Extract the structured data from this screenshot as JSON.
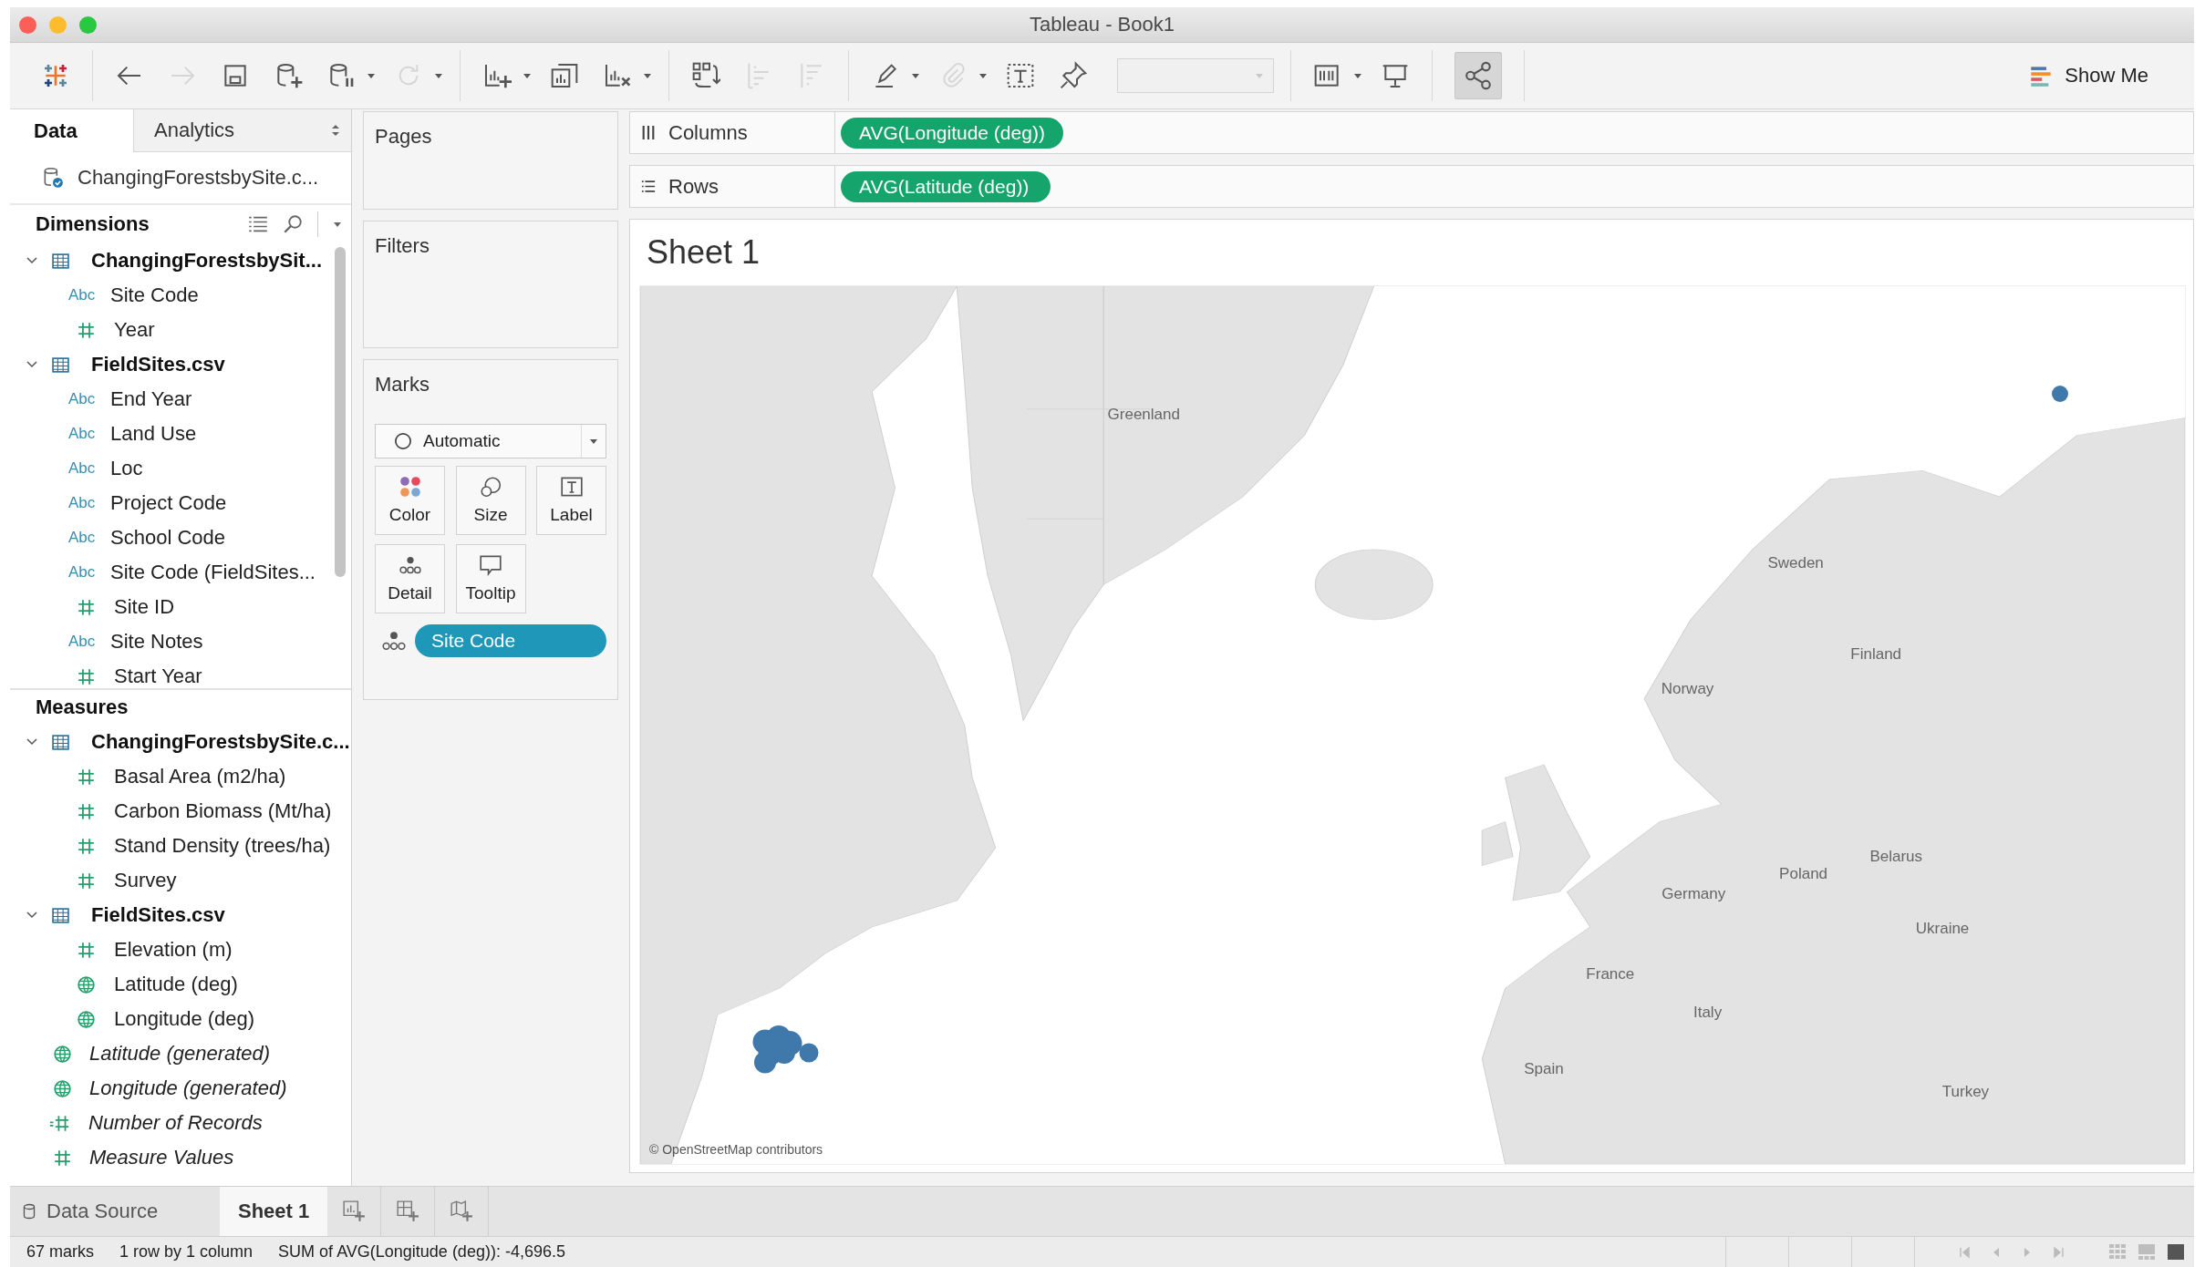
{
  "window": {
    "title": "Tableau - Book1"
  },
  "toolbar": {
    "groups": [
      [
        {
          "kind": "logo",
          "disabled": false,
          "menu": false,
          "on": false
        }
      ],
      [
        {
          "kind": "back",
          "disabled": false,
          "menu": false,
          "on": false
        },
        {
          "kind": "forward",
          "disabled": true,
          "menu": false,
          "on": false
        },
        {
          "kind": "save",
          "disabled": false,
          "menu": false,
          "on": false
        },
        {
          "kind": "new-data-source",
          "disabled": false,
          "menu": false,
          "on": false
        },
        {
          "kind": "pause",
          "disabled": false,
          "menu": true,
          "on": false
        },
        {
          "kind": "refresh",
          "disabled": true,
          "menu": true,
          "on": false
        }
      ],
      [
        {
          "kind": "new-worksheet",
          "disabled": false,
          "menu": true,
          "on": false
        },
        {
          "kind": "duplicate",
          "disabled": false,
          "menu": false,
          "on": false
        },
        {
          "kind": "clear",
          "disabled": false,
          "menu": true,
          "on": false
        }
      ],
      [
        {
          "kind": "swap",
          "disabled": false,
          "menu": false,
          "on": false
        },
        {
          "kind": "sort-ascending",
          "disabled": true,
          "menu": false,
          "on": false
        },
        {
          "kind": "sort-descending",
          "disabled": true,
          "menu": false,
          "on": false
        }
      ],
      [
        {
          "kind": "highlight",
          "disabled": false,
          "menu": true,
          "on": false
        },
        {
          "kind": "annotate",
          "disabled": true,
          "menu": true,
          "on": false
        },
        {
          "kind": "text",
          "disabled": false,
          "menu": false,
          "on": false
        },
        {
          "kind": "pin",
          "disabled": false,
          "menu": false,
          "on": false
        },
        {
          "kind": "combo",
          "disabled": true
        }
      ],
      [
        {
          "kind": "fit",
          "disabled": false,
          "menu": true,
          "on": false
        },
        {
          "kind": "presentation",
          "disabled": false,
          "menu": false,
          "on": false
        }
      ],
      [
        {
          "kind": "share",
          "disabled": false,
          "menu": false,
          "on": true
        }
      ]
    ],
    "show_me": {
      "label": "Show Me"
    }
  },
  "data_pane": {
    "tabs": [
      {
        "label": "Data",
        "selected": true
      },
      {
        "label": "Analytics",
        "selected": false
      }
    ],
    "data_source": "ChangingForestsbySite.c...",
    "dimensions": {
      "title": "Dimensions",
      "items": [
        {
          "kind": "table",
          "label": "ChangingForestsbySit...",
          "expanded": true,
          "children": [
            {
              "kind": "string",
              "badge": "Abc",
              "label": "Site Code",
              "generated": false
            },
            {
              "kind": "number",
              "label": "Year",
              "generated": false
            }
          ]
        },
        {
          "kind": "table",
          "label": "FieldSites.csv",
          "expanded": true,
          "children": [
            {
              "kind": "string",
              "badge": "Abc",
              "label": "End Year",
              "generated": false
            },
            {
              "kind": "string",
              "badge": "Abc",
              "label": "Land Use",
              "generated": false
            },
            {
              "kind": "string",
              "badge": "Abc",
              "label": "Loc",
              "generated": false
            },
            {
              "kind": "string",
              "badge": "Abc",
              "label": "Project Code",
              "generated": false
            },
            {
              "kind": "string",
              "badge": "Abc",
              "label": "School Code",
              "generated": false
            },
            {
              "kind": "string",
              "badge": "Abc",
              "label": "Site Code (FieldSites...",
              "generated": false
            },
            {
              "kind": "number",
              "label": "Site ID",
              "generated": false
            },
            {
              "kind": "string",
              "badge": "Abc",
              "label": "Site Notes",
              "generated": false
            },
            {
              "kind": "number",
              "label": "Start Year",
              "generated": false
            }
          ]
        }
      ]
    },
    "measures": {
      "title": "Measures",
      "items": [
        {
          "kind": "table",
          "label": "ChangingForestsbySite.c...",
          "expanded": true,
          "children": [
            {
              "kind": "number",
              "label": "Basal Area (m2/ha)",
              "generated": false
            },
            {
              "kind": "number",
              "label": "Carbon Biomass (Mt/ha)",
              "generated": false
            },
            {
              "kind": "number",
              "label": "Stand Density (trees/ha)",
              "generated": false
            },
            {
              "kind": "number",
              "label": "Survey",
              "generated": false
            }
          ]
        },
        {
          "kind": "table",
          "label": "FieldSites.csv",
          "expanded": true,
          "children": [
            {
              "kind": "number",
              "label": "Elevation (m)",
              "generated": false
            },
            {
              "kind": "geo",
              "label": "Latitude (deg)",
              "generated": false
            },
            {
              "kind": "geo",
              "label": "Longitude (deg)",
              "generated": false
            }
          ]
        },
        {
          "kind": "geo",
          "label": "Latitude (generated)",
          "generated": true
        },
        {
          "kind": "geo",
          "label": "Longitude (generated)",
          "generated": true
        },
        {
          "kind": "calc-number",
          "label": "Number of Records",
          "generated": true
        },
        {
          "kind": "number",
          "label": "Measure Values",
          "generated": true
        }
      ]
    }
  },
  "pages": {
    "title": "Pages"
  },
  "filters": {
    "title": "Filters"
  },
  "marks": {
    "title": "Marks",
    "mark_type": "Automatic",
    "buttons": [
      {
        "kind": "color",
        "label": "Color"
      },
      {
        "kind": "size",
        "label": "Size"
      },
      {
        "kind": "label",
        "label": "Label"
      },
      {
        "kind": "detail",
        "label": "Detail"
      },
      {
        "kind": "tooltip",
        "label": "Tooltip"
      }
    ],
    "pills": [
      {
        "kind": "detail",
        "label": "Site Code"
      }
    ]
  },
  "shelves": [
    {
      "kind": "columns",
      "label": "Columns",
      "pills": [
        "AVG(Longitude (deg))"
      ]
    },
    {
      "kind": "rows",
      "label": "Rows",
      "pills": [
        "AVG(Latitude (deg))"
      ]
    }
  ],
  "sheet": {
    "title": "Sheet 1",
    "map": {
      "labels": [
        "Greenland",
        "Sweden",
        "Finland",
        "Norway",
        "Belarus",
        "Poland",
        "Germany",
        "Ukraine",
        "France",
        "Italy",
        "Spain",
        "Turkey"
      ],
      "attribution": "© OpenStreetMap contributors"
    }
  },
  "sheet_tabs": [
    {
      "kind": "data-source",
      "label": "Data Source",
      "selected": false
    },
    {
      "kind": "sheet",
      "label": "Sheet 1",
      "selected": true
    }
  ],
  "new_sheet_buttons": [
    {
      "kind": "worksheet"
    },
    {
      "kind": "dashboard"
    },
    {
      "kind": "story"
    }
  ],
  "status_bar": {
    "texts": [
      "67 marks",
      "1 row by 1 column",
      "SUM of AVG(Longitude (deg)): -4,696.5"
    ],
    "views": [
      {
        "kind": "grid",
        "selected": false
      },
      {
        "kind": "filmstrip",
        "selected": false
      },
      {
        "kind": "single",
        "selected": true
      }
    ]
  }
}
